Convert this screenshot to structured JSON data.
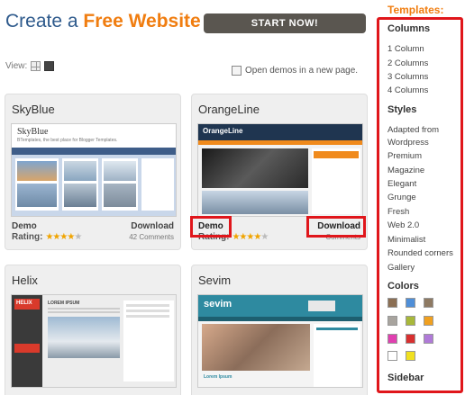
{
  "banner": {
    "title_plain": "Create a",
    "title_accent": "Free Website",
    "start_button": "START NOW!"
  },
  "view": {
    "label": "View:"
  },
  "open_demos_label": "Open demos in a new page.",
  "cards": [
    {
      "title": "SkyBlue",
      "demo": "Demo",
      "rating_label": "Rating:",
      "rating": 4,
      "download": "Download",
      "comments": "42 Comments",
      "thumb_title": "SkyBlue",
      "thumb_subtitle": "BTemplates, the best place for Blogger Templates."
    },
    {
      "title": "OrangeLine",
      "demo": "Demo",
      "rating_label": "Rating:",
      "rating": 4,
      "download": "Download",
      "comments": "Comments",
      "thumb_title": "OrangeLine"
    },
    {
      "title": "Helix",
      "thumb_title": "HELIX",
      "thumb_post": "LOREM IPSUM"
    },
    {
      "title": "Sevim",
      "thumb_title": "sevim",
      "thumb_post": "Lorem Ipsum"
    }
  ],
  "sidebar": {
    "top_heading": "Templates:",
    "columns_heading": "Columns",
    "columns": [
      "1 Column",
      "2 Columns",
      "3 Columns",
      "4 Columns"
    ],
    "styles_heading": "Styles",
    "styles": [
      "Adapted from",
      "Wordpress",
      "Premium",
      "Magazine",
      "Elegant",
      "Grunge",
      "Fresh",
      "Web 2.0",
      "Minimalist",
      "Rounded corners",
      "Gallery"
    ],
    "colors_heading": "Colors",
    "colors": [
      "#8b6f54",
      "#4f8fd8",
      "#8e7a63",
      "#a8a49e",
      "#a8b83a",
      "#f0a020",
      "#e040b0",
      "#d83030",
      "#b07ad8",
      "#ffffff",
      "#f0e020"
    ],
    "sidebar_heading": "Sidebar"
  },
  "colors": {
    "accent": "#f07d10",
    "brand_blue": "#2e5a8c",
    "highlight_red": "#e0161b"
  }
}
